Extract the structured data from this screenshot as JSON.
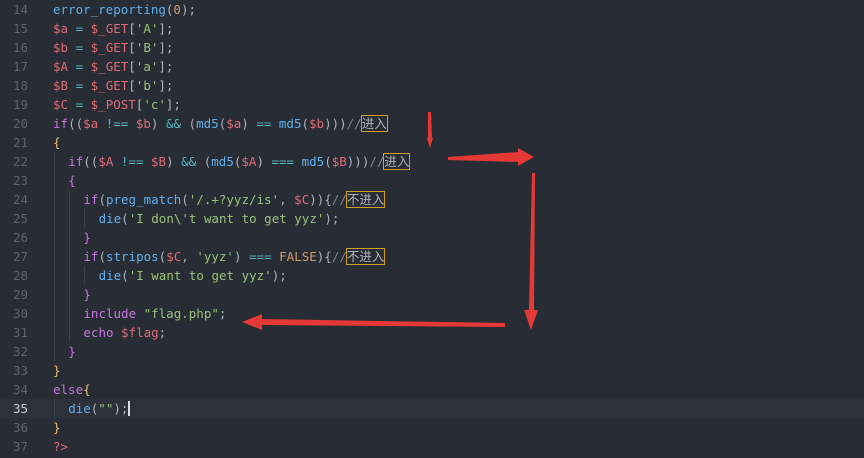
{
  "editor": {
    "active_line": "35",
    "lines": [
      {
        "num": "14",
        "indent": 0,
        "tokens": [
          {
            "t": "error_reporting",
            "c": "fn"
          },
          {
            "t": "(",
            "c": "punc"
          },
          {
            "t": "0",
            "c": "num"
          },
          {
            "t": ");",
            "c": "punc"
          }
        ]
      },
      {
        "num": "15",
        "indent": 0,
        "tokens": [
          {
            "t": "$a",
            "c": "var"
          },
          {
            "t": " = ",
            "c": "op"
          },
          {
            "t": "$_GET",
            "c": "var"
          },
          {
            "t": "[",
            "c": "punc"
          },
          {
            "t": "'A'",
            "c": "str"
          },
          {
            "t": "];",
            "c": "punc"
          }
        ]
      },
      {
        "num": "16",
        "indent": 0,
        "tokens": [
          {
            "t": "$b",
            "c": "var"
          },
          {
            "t": " = ",
            "c": "op"
          },
          {
            "t": "$_GET",
            "c": "var"
          },
          {
            "t": "[",
            "c": "punc"
          },
          {
            "t": "'B'",
            "c": "str"
          },
          {
            "t": "];",
            "c": "punc"
          }
        ]
      },
      {
        "num": "17",
        "indent": 0,
        "tokens": [
          {
            "t": "$A",
            "c": "var"
          },
          {
            "t": " = ",
            "c": "op"
          },
          {
            "t": "$_GET",
            "c": "var"
          },
          {
            "t": "[",
            "c": "punc"
          },
          {
            "t": "'a'",
            "c": "str"
          },
          {
            "t": "];",
            "c": "punc"
          }
        ]
      },
      {
        "num": "18",
        "indent": 0,
        "tokens": [
          {
            "t": "$B",
            "c": "var"
          },
          {
            "t": " = ",
            "c": "op"
          },
          {
            "t": "$_GET",
            "c": "var"
          },
          {
            "t": "[",
            "c": "punc"
          },
          {
            "t": "'b'",
            "c": "str"
          },
          {
            "t": "];",
            "c": "punc"
          }
        ]
      },
      {
        "num": "19",
        "indent": 0,
        "tokens": [
          {
            "t": "$C",
            "c": "var"
          },
          {
            "t": " = ",
            "c": "op"
          },
          {
            "t": "$_POST",
            "c": "var"
          },
          {
            "t": "[",
            "c": "punc"
          },
          {
            "t": "'c'",
            "c": "str"
          },
          {
            "t": "];",
            "c": "punc"
          }
        ]
      },
      {
        "num": "20",
        "indent": 0,
        "tokens": [
          {
            "t": "if",
            "c": "kw"
          },
          {
            "t": "((",
            "c": "punc"
          },
          {
            "t": "$a",
            "c": "var"
          },
          {
            "t": " !== ",
            "c": "op"
          },
          {
            "t": "$b",
            "c": "var"
          },
          {
            "t": ") ",
            "c": "punc"
          },
          {
            "t": "&&",
            "c": "op"
          },
          {
            "t": " (",
            "c": "punc"
          },
          {
            "t": "md5",
            "c": "fn"
          },
          {
            "t": "(",
            "c": "punc"
          },
          {
            "t": "$a",
            "c": "var"
          },
          {
            "t": ") ",
            "c": "punc"
          },
          {
            "t": "==",
            "c": "op"
          },
          {
            "t": " ",
            "c": "punc"
          },
          {
            "t": "md5",
            "c": "fn"
          },
          {
            "t": "(",
            "c": "punc"
          },
          {
            "t": "$b",
            "c": "var"
          },
          {
            "t": ")))",
            "c": "punc"
          },
          {
            "t": "//",
            "c": "cm"
          },
          {
            "t": "进入",
            "c": "boxed"
          }
        ]
      },
      {
        "num": "21",
        "indent": 0,
        "tokens": [
          {
            "t": "{",
            "c": "yel"
          }
        ]
      },
      {
        "num": "22",
        "indent": 1,
        "tokens": [
          {
            "t": "if",
            "c": "kw"
          },
          {
            "t": "((",
            "c": "punc"
          },
          {
            "t": "$A",
            "c": "var"
          },
          {
            "t": " !== ",
            "c": "op"
          },
          {
            "t": "$B",
            "c": "var"
          },
          {
            "t": ") ",
            "c": "punc"
          },
          {
            "t": "&&",
            "c": "op"
          },
          {
            "t": " (",
            "c": "punc"
          },
          {
            "t": "md5",
            "c": "fn"
          },
          {
            "t": "(",
            "c": "punc"
          },
          {
            "t": "$A",
            "c": "var"
          },
          {
            "t": ") ",
            "c": "punc"
          },
          {
            "t": "===",
            "c": "op"
          },
          {
            "t": " ",
            "c": "punc"
          },
          {
            "t": "md5",
            "c": "fn"
          },
          {
            "t": "(",
            "c": "punc"
          },
          {
            "t": "$B",
            "c": "var"
          },
          {
            "t": ")))",
            "c": "punc"
          },
          {
            "t": "//",
            "c": "cm"
          },
          {
            "t": "进入",
            "c": "boxed"
          }
        ]
      },
      {
        "num": "23",
        "indent": 1,
        "tokens": [
          {
            "t": "{",
            "c": "kw"
          }
        ]
      },
      {
        "num": "24",
        "indent": 2,
        "tokens": [
          {
            "t": "if",
            "c": "kw"
          },
          {
            "t": "(",
            "c": "punc"
          },
          {
            "t": "preg_match",
            "c": "fn"
          },
          {
            "t": "(",
            "c": "punc"
          },
          {
            "t": "'/.+?yyz/is'",
            "c": "str"
          },
          {
            "t": ", ",
            "c": "punc"
          },
          {
            "t": "$C",
            "c": "var"
          },
          {
            "t": ")){",
            "c": "punc"
          },
          {
            "t": "//",
            "c": "cm"
          },
          {
            "t": "不进入",
            "c": "boxed"
          }
        ]
      },
      {
        "num": "25",
        "indent": 3,
        "tokens": [
          {
            "t": "die",
            "c": "fn"
          },
          {
            "t": "(",
            "c": "punc"
          },
          {
            "t": "'I don\\'t want to get yyz'",
            "c": "str"
          },
          {
            "t": ");",
            "c": "punc"
          }
        ]
      },
      {
        "num": "26",
        "indent": 2,
        "tokens": [
          {
            "t": "}",
            "c": "kw"
          }
        ]
      },
      {
        "num": "27",
        "indent": 2,
        "tokens": [
          {
            "t": "if",
            "c": "kw"
          },
          {
            "t": "(",
            "c": "punc"
          },
          {
            "t": "stripos",
            "c": "fn"
          },
          {
            "t": "(",
            "c": "punc"
          },
          {
            "t": "$C",
            "c": "var"
          },
          {
            "t": ", ",
            "c": "punc"
          },
          {
            "t": "'yyz'",
            "c": "str"
          },
          {
            "t": ") ",
            "c": "punc"
          },
          {
            "t": "===",
            "c": "op"
          },
          {
            "t": " ",
            "c": "punc"
          },
          {
            "t": "FALSE",
            "c": "num"
          },
          {
            "t": "){",
            "c": "punc"
          },
          {
            "t": "//",
            "c": "cm"
          },
          {
            "t": "不进入",
            "c": "boxed"
          }
        ]
      },
      {
        "num": "28",
        "indent": 3,
        "tokens": [
          {
            "t": "die",
            "c": "fn"
          },
          {
            "t": "(",
            "c": "punc"
          },
          {
            "t": "'I want to get yyz'",
            "c": "str"
          },
          {
            "t": ");",
            "c": "punc"
          }
        ]
      },
      {
        "num": "29",
        "indent": 2,
        "tokens": [
          {
            "t": "}",
            "c": "kw"
          }
        ]
      },
      {
        "num": "30",
        "indent": 2,
        "tokens": [
          {
            "t": "include",
            "c": "kw"
          },
          {
            "t": " ",
            "c": "punc"
          },
          {
            "t": "\"flag.php\"",
            "c": "str"
          },
          {
            "t": ";",
            "c": "punc"
          }
        ]
      },
      {
        "num": "31",
        "indent": 2,
        "tokens": [
          {
            "t": "echo",
            "c": "kw"
          },
          {
            "t": " ",
            "c": "punc"
          },
          {
            "t": "$flag",
            "c": "var"
          },
          {
            "t": ";",
            "c": "punc"
          }
        ]
      },
      {
        "num": "32",
        "indent": 1,
        "tokens": [
          {
            "t": "}",
            "c": "kw"
          }
        ]
      },
      {
        "num": "33",
        "indent": 0,
        "tokens": [
          {
            "t": "}",
            "c": "yel"
          }
        ]
      },
      {
        "num": "34",
        "indent": 0,
        "tokens": [
          {
            "t": "else",
            "c": "kw"
          },
          {
            "t": "{",
            "c": "yel"
          }
        ]
      },
      {
        "num": "35",
        "indent": 1,
        "tokens": [
          {
            "t": "die",
            "c": "fn"
          },
          {
            "t": "(",
            "c": "punc"
          },
          {
            "t": "\"\"",
            "c": "str"
          },
          {
            "t": ");",
            "c": "punc"
          }
        ],
        "cursor": true
      },
      {
        "num": "36",
        "indent": 0,
        "tokens": [
          {
            "t": "}",
            "c": "yel"
          }
        ]
      },
      {
        "num": "37",
        "indent": 0,
        "tokens": [
          {
            "t": "?>",
            "c": "var"
          }
        ]
      }
    ]
  },
  "annotations": {
    "arrow_color": "#e53935",
    "arrow_count": 4
  }
}
